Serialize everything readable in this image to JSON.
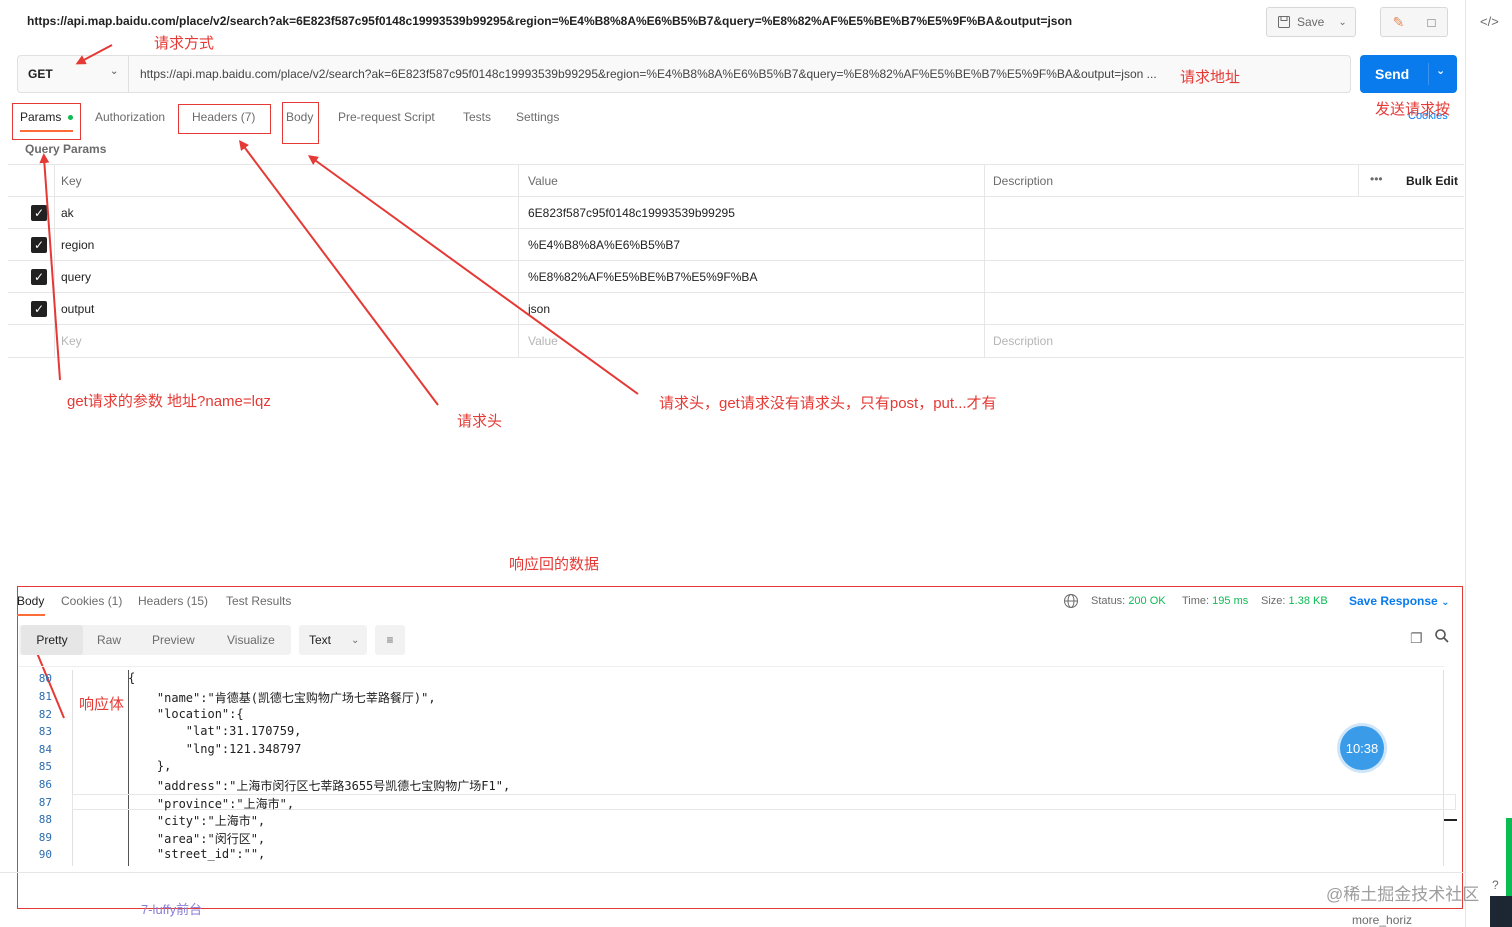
{
  "request": {
    "title_url": "https://api.map.baidu.com/place/v2/search?ak=6E823f587c95f0148c19993539b99295&region=%E4%B8%8A%E6%B5%B7&query=%E8%82%AF%E5%BE%B7%E5%9F%BA&output=json",
    "method": "GET",
    "url": "https://api.map.baidu.com/place/v2/search?ak=6E823f587c95f0148c19993539b99295&region=%E4%B8%8A%E6%B5%B7&query=%E8%82%AF%E5%BE%B7%E5%9F%BA&output=json ...",
    "save_label": "Save",
    "send_label": "Send",
    "cookies_label": "Cookies"
  },
  "tabs": [
    "Params",
    "Authorization",
    "Headers (7)",
    "Body",
    "Pre-request Script",
    "Tests",
    "Settings"
  ],
  "query_params": {
    "title": "Query Params",
    "columns": [
      "Key",
      "Value",
      "Description"
    ],
    "bulk_edit": "Bulk Edit",
    "rows": [
      {
        "key": "ak",
        "value": "6E823f587c95f0148c19993539b99295"
      },
      {
        "key": "region",
        "value": "%E4%B8%8A%E6%B5%B7"
      },
      {
        "key": "query",
        "value": "%E8%82%AF%E5%BE%B7%E5%9F%BA"
      },
      {
        "key": "output",
        "value": "json"
      }
    ],
    "placeholders": {
      "key": "Key",
      "value": "Value",
      "description": "Description"
    }
  },
  "annotations": {
    "method": "请求方式",
    "url": "请求地址",
    "send": "发送请求按",
    "params": "get请求的参数   地址?name=lqz",
    "headers": "请求头",
    "body": "请求头，get请求没有请求头，只有post，put...才有",
    "response": "响应回的数据",
    "response_body": "响应体"
  },
  "response": {
    "tabs": [
      "Body",
      "Cookies (1)",
      "Headers (15)",
      "Test Results"
    ],
    "status_label": "Status:",
    "status_value": "200 OK",
    "time_label": "Time:",
    "time_value": "195 ms",
    "size_label": "Size:",
    "size_value": "1.38 KB",
    "save_response": "Save Response",
    "formats": [
      "Pretty",
      "Raw",
      "Preview",
      "Visualize"
    ],
    "type_select": "Text",
    "lines": [
      {
        "n": "80",
        "text": "{"
      },
      {
        "n": "81",
        "text": "    \"name\":\"肯德基(凯德七宝购物广场七莘路餐厅)\","
      },
      {
        "n": "82",
        "text": "    \"location\":{"
      },
      {
        "n": "83",
        "text": "        \"lat\":31.170759,"
      },
      {
        "n": "84",
        "text": "        \"lng\":121.348797"
      },
      {
        "n": "85",
        "text": "    },"
      },
      {
        "n": "86",
        "text": "    \"address\":\"上海市闵行区七莘路3655号凯德七宝购物广场F1\","
      },
      {
        "n": "87",
        "text": "    \"province\":\"上海市\","
      },
      {
        "n": "88",
        "text": "    \"city\":\"上海市\","
      },
      {
        "n": "89",
        "text": "    \"area\":\"闵行区\","
      },
      {
        "n": "90",
        "text": "    \"street_id\":\"\","
      }
    ]
  },
  "misc": {
    "time_badge": "10:38",
    "watermark": "@稀土掘金技术社区",
    "footer_left": "7-luffy前台",
    "footer_right": "more_horiz"
  }
}
